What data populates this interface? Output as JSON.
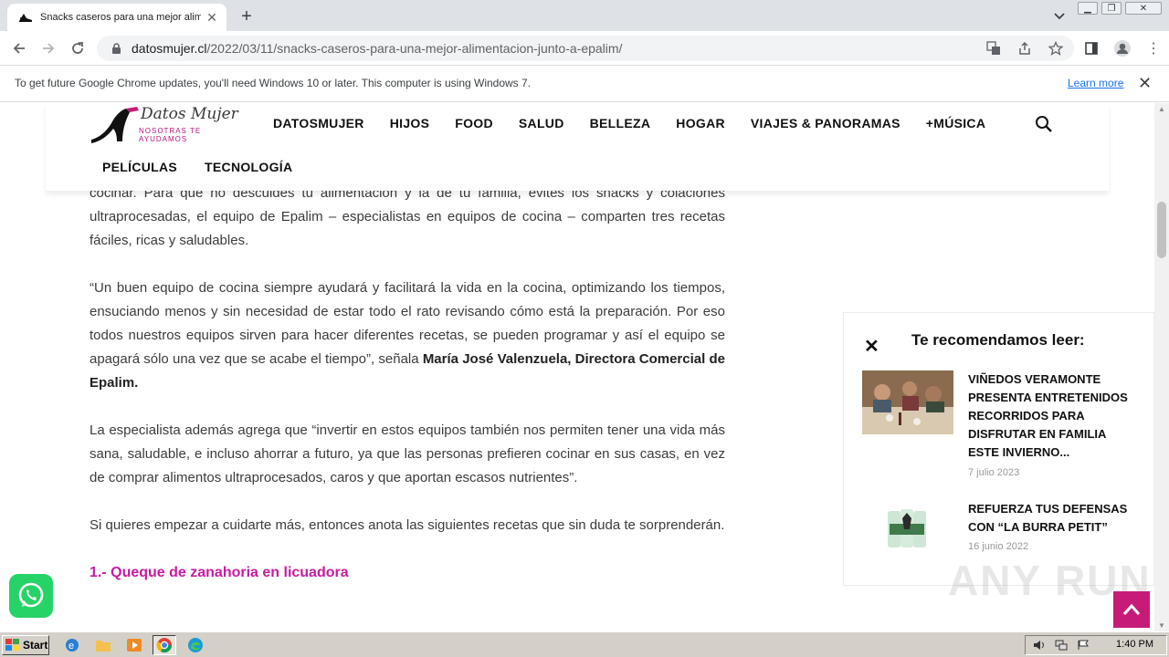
{
  "browser": {
    "tab_title": "Snacks caseros para una mejor alimentación junto a Epalim",
    "url_host": "datosmujer.cl",
    "url_path": "/2022/03/11/snacks-caseros-para-una-mejor-alimentacion-junto-a-epalim/",
    "infobar_text": "To get future Google Chrome updates, you'll need Windows 10 or later. This computer is using Windows 7.",
    "infobar_link": "Learn more"
  },
  "site": {
    "logo_name": "Datos Mujer",
    "logo_tagline": "NOSOTRAS TE AYUDAMOS",
    "nav": [
      "DATOSMUJER",
      "HIJOS",
      "FOOD",
      "SALUD",
      "BELLEZA",
      "HOGAR",
      "VIAJES & PANORAMAS",
      "+MÚSICA"
    ],
    "nav2": [
      "PELÍCULAS",
      "TECNOLOGÍA"
    ]
  },
  "article": {
    "p1_visible": "cocinar. Para que no descuides tu alimentación y la de tu familia, evites los snacks y colaciones ultraprocesadas, el equipo de Epalim – especialistas en equipos de cocina – comparten tres recetas fáciles, ricas y saludables.",
    "p2": "“Un buen equipo de cocina siempre ayudará y facilitará la vida en la cocina, optimizando los tiempos, ensuciando menos y sin necesidad de estar todo el rato revisando cómo está la preparación. Por eso todos nuestros equipos sirven para hacer diferentes recetas, se pueden programar y así el equipo se apagará sólo una vez que se acabe el tiempo”, señala ",
    "p2_strong": "María José Valenzuela, Directora Comercial de Epalim.",
    "p3": " La especialista además agrega que “invertir en estos equipos también nos permiten tener una vida más sana, saludable, e incluso ahorrar a futuro, ya que las personas prefieren cocinar en sus casas, en vez de comprar alimentos ultraprocesados, caros y que aportan escasos nutrientes”.",
    "p4": "Si quieres empezar a cuidarte más, entonces anota las siguientes recetas que sin duda te sorprenderán.",
    "h3": "1.- Queque de zanahoria en licuadora"
  },
  "recommend": {
    "title": "Te recomendamos leer:",
    "items": [
      {
        "headline": "VIÑEDOS VERAMONTE PRESENTA ENTRETENIDOS RECORRIDOS PARA DISFRUTAR EN FAMILIA ESTE INVIERNO...",
        "date": "7 julio 2023"
      },
      {
        "headline": "REFUERZA TUS DEFENSAS CON “LA BURRA PETIT”",
        "date": "16 junio 2022"
      }
    ]
  },
  "watermark": "ANY RUN",
  "taskbar": {
    "start_label": "Start",
    "clock": "1:40 PM"
  }
}
